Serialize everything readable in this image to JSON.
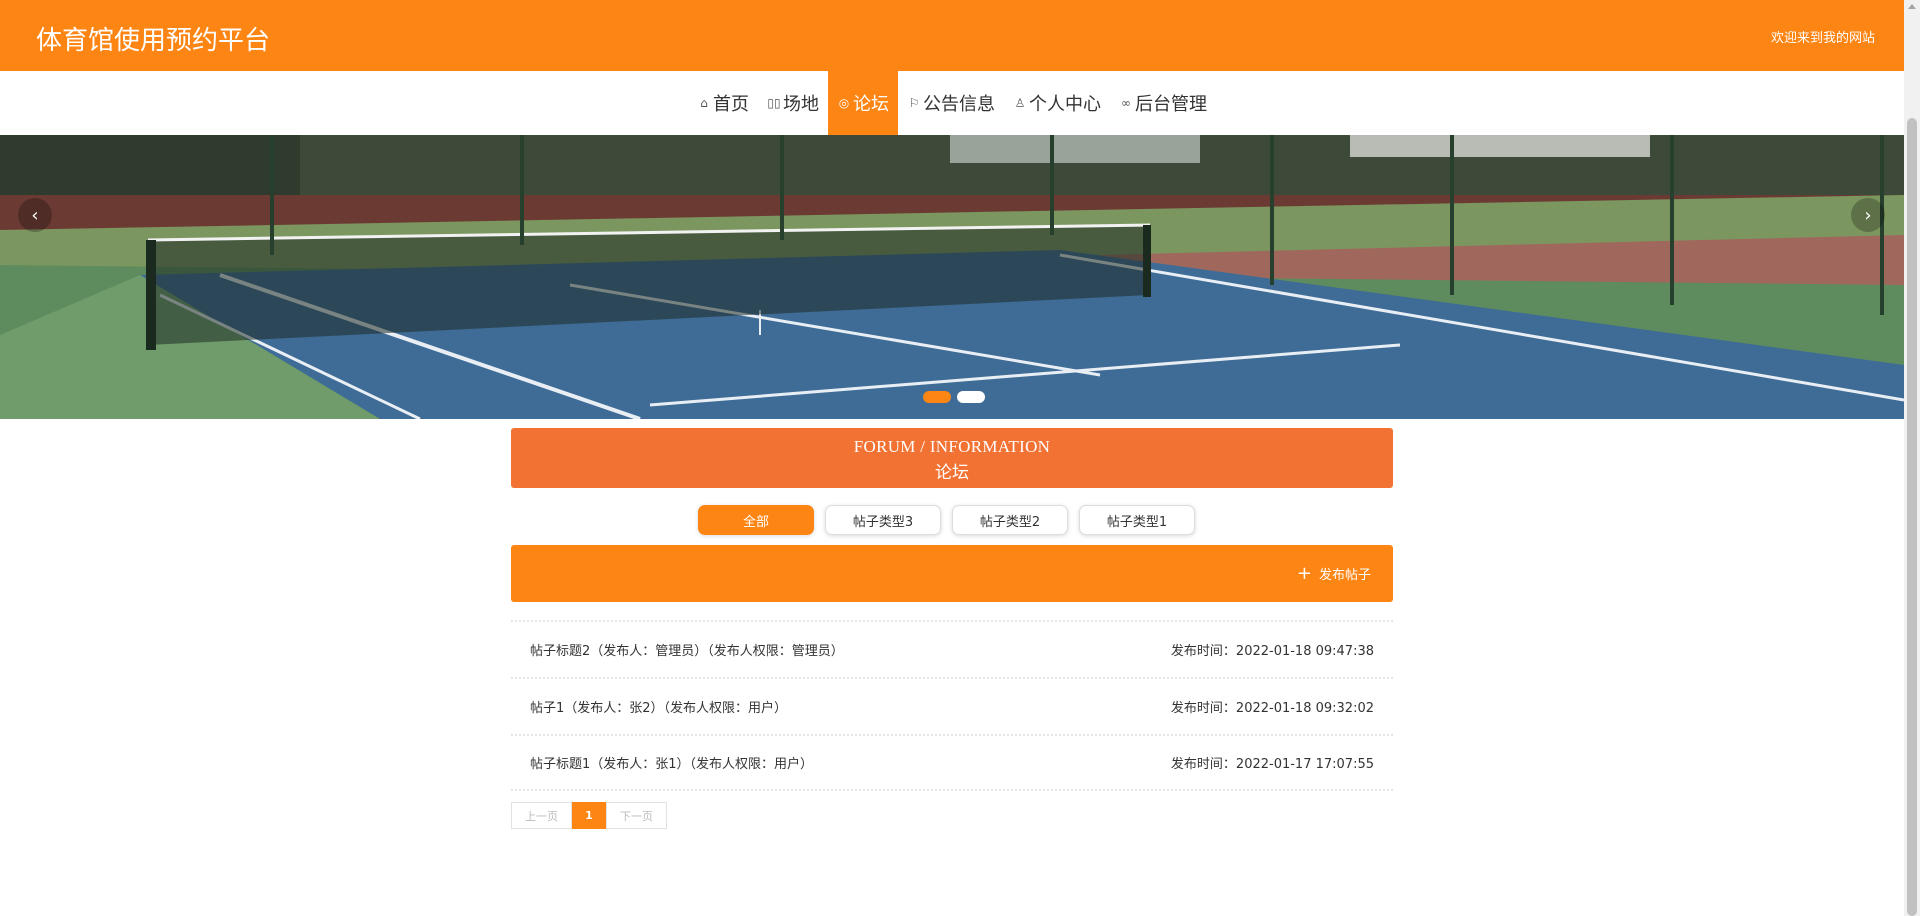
{
  "header": {
    "title": "体育馆使用预约平台",
    "welcome": "欢迎来到我的网站"
  },
  "nav": {
    "items": [
      {
        "label": "首页",
        "icon": "home-icon"
      },
      {
        "label": "场地",
        "icon": "venue-icon"
      },
      {
        "label": "论坛",
        "icon": "forum-icon",
        "active": true
      },
      {
        "label": "公告信息",
        "icon": "flag-icon"
      },
      {
        "label": "个人中心",
        "icon": "user-icon"
      },
      {
        "label": "后台管理",
        "icon": "link-icon"
      }
    ]
  },
  "banner": {
    "left_arrow": "‹",
    "right_arrow": "›",
    "slide_count": 2,
    "active_slide": 1
  },
  "section": {
    "title_en": "FORUM / INFORMATION",
    "title_cn": "论坛"
  },
  "filters": [
    "全部",
    "帖子类型3",
    "帖子类型2",
    "帖子类型1"
  ],
  "action": {
    "post_label": "发布帖子",
    "post_icon": "plus-icon"
  },
  "posts": [
    {
      "title": "帖子标题2（发布人：管理员）（发布人权限：管理员）",
      "time": "发布时间：2022-01-18 09:47:38"
    },
    {
      "title": "帖子1（发布人：张2）（发布人权限：用户）",
      "time": "发布时间：2022-01-18 09:32:02"
    },
    {
      "title": "帖子标题1（发布人：张1）（发布人权限：用户）",
      "time": "发布时间：2022-01-17 17:07:55"
    }
  ],
  "pagination": {
    "prev": "上一页",
    "current": "1",
    "next": "下一页"
  },
  "colors": {
    "accent": "#fd8514",
    "section_title": "#f27233"
  }
}
